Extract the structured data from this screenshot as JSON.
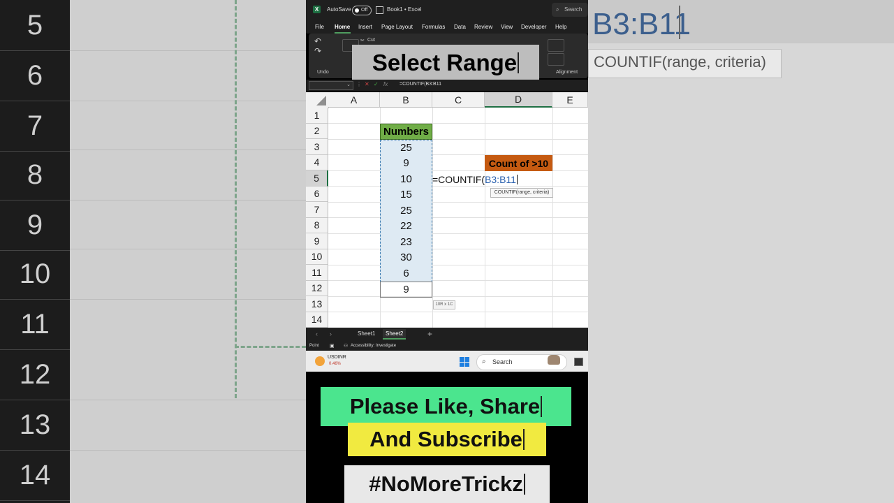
{
  "app": {
    "autosave_label": "AutoSave",
    "autosave_state": "Off",
    "title": "Book1 • Excel",
    "search_label": "Search"
  },
  "menu": [
    "File",
    "Home",
    "Insert",
    "Page Layout",
    "Formulas",
    "Data",
    "Review",
    "View",
    "Developer",
    "Help"
  ],
  "ribbon": {
    "cut_label": "Cut",
    "undo_group": "Undo",
    "alignment_group": "Alignment"
  },
  "overlay_title": "Select Range",
  "formula_bar": {
    "formula": "=COUNTIF(B3:B11"
  },
  "grid": {
    "columns": [
      "A",
      "B",
      "C",
      "D",
      "E"
    ],
    "rows": [
      "1",
      "2",
      "3",
      "4",
      "5",
      "6",
      "7",
      "8",
      "9",
      "10",
      "11",
      "12",
      "13",
      "14"
    ],
    "numbers_header": "Numbers",
    "numbers": [
      "25",
      "9",
      "10",
      "15",
      "25",
      "22",
      "23",
      "30",
      "6"
    ],
    "row12_value": "9",
    "count_label": "Count of >10",
    "formula_prefix": "=COUNTIF(",
    "formula_ref": "B3:B11",
    "tooltip": "COUNTIF(range, criteria)",
    "size_tip": "10R x 1C"
  },
  "sheets": {
    "tabs": [
      "Sheet1",
      "Sheet2"
    ],
    "active": "Sheet2",
    "add": "+"
  },
  "status": {
    "mode": "Point",
    "accessibility": "Accessibility: Investigate"
  },
  "taskbar": {
    "ticker_name": "USDINR",
    "ticker_change": "0.46%",
    "search_label": "Search"
  },
  "cta": {
    "line1": "Please Like, Share",
    "line2": "And Subscribe",
    "hashtag": "#NoMoreTrickz"
  },
  "background": {
    "row_numbers": [
      "5",
      "6",
      "7",
      "8",
      "9",
      "10",
      "11",
      "12",
      "13",
      "14"
    ],
    "formula_ref": "B3:B11",
    "hint": "COUNTIF(range, criteria)"
  },
  "colors": {
    "header_green": "#70ad47",
    "count_orange": "#c55a11",
    "cta_green": "#4be58e",
    "cta_yellow": "#f1ea40",
    "excel_green": "#1d6f42"
  }
}
